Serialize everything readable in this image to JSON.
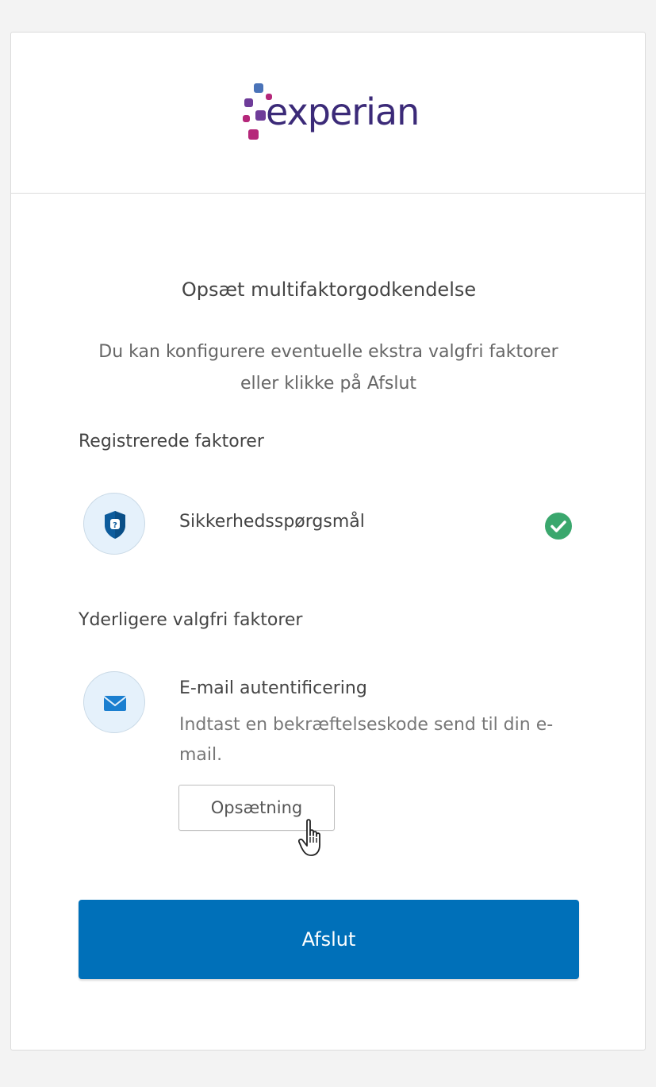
{
  "brand": {
    "name": "experian",
    "colors": {
      "navy": "#3b2a78",
      "purple": "#6e3c99",
      "magenta": "#b5277a",
      "blue": "#4a73b8"
    }
  },
  "page": {
    "title": "Opsæt multifaktorgodkendelse",
    "subtitle": "Du kan konfigurere eventuelle ekstra valgfri faktorer eller klikke på Afslut"
  },
  "registered": {
    "label": "Registrerede faktorer",
    "factors": [
      {
        "name": "Sikkerhedsspørgsmål",
        "icon": "shield-question-icon",
        "status": "enrolled",
        "status_icon": "check-circle-icon"
      }
    ]
  },
  "optional": {
    "label": "Yderligere valgfri faktorer",
    "factors": [
      {
        "name": "E-mail autentificering",
        "description": "Indtast en bekræftelseskode send til din e-mail.",
        "icon": "envelope-icon",
        "button_label": "Opsætning"
      }
    ]
  },
  "actions": {
    "finish_label": "Afslut",
    "finish_color": "#0070b9"
  },
  "status_colors": {
    "success": "#3aa76d"
  }
}
